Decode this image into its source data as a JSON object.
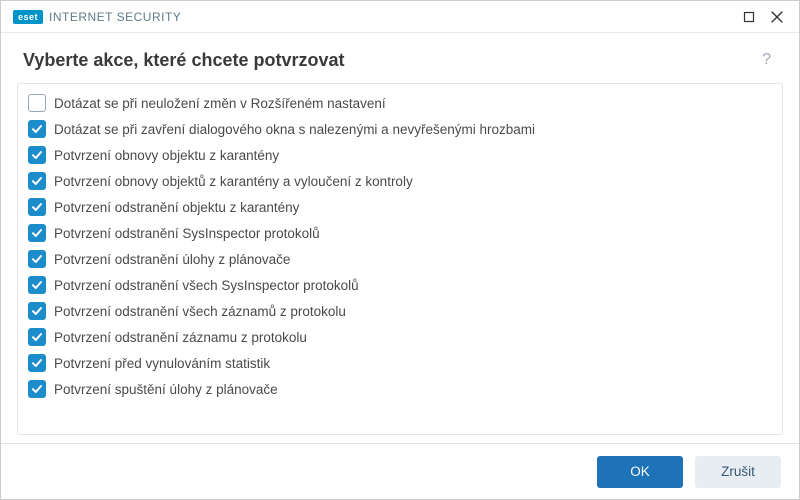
{
  "titlebar": {
    "brand_badge": "eset",
    "brand_text": "INTERNET SECURITY"
  },
  "header": {
    "title": "Vyberte akce, které chcete potvrzovat",
    "help": "?"
  },
  "options": [
    {
      "label": "Dotázat se při neuložení změn v Rozšířeném nastavení",
      "checked": false
    },
    {
      "label": "Dotázat se při zavření dialogového okna s nalezenými a nevyřešenými hrozbami",
      "checked": true
    },
    {
      "label": "Potvrzení obnovy objektu z karantény",
      "checked": true
    },
    {
      "label": "Potvrzení obnovy objektů z karantény a vyloučení z kontroly",
      "checked": true
    },
    {
      "label": "Potvrzení odstranění objektu z karantény",
      "checked": true
    },
    {
      "label": "Potvrzení odstranění SysInspector protokolů",
      "checked": true
    },
    {
      "label": "Potvrzení odstranění úlohy z plánovače",
      "checked": true
    },
    {
      "label": "Potvrzení odstranění všech SysInspector protokolů",
      "checked": true
    },
    {
      "label": "Potvrzení odstranění všech záznamů z protokolu",
      "checked": true
    },
    {
      "label": "Potvrzení odstranění záznamu z protokolu",
      "checked": true
    },
    {
      "label": "Potvrzení před vynulováním statistik",
      "checked": true
    },
    {
      "label": "Potvrzení spuštění úlohy z plánovače",
      "checked": true
    }
  ],
  "footer": {
    "ok": "OK",
    "cancel": "Zrušit"
  }
}
